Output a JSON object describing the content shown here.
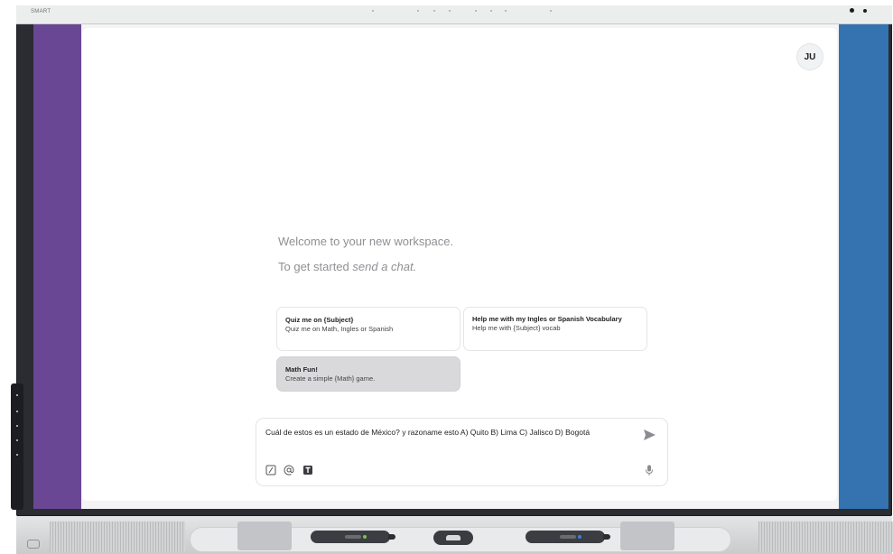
{
  "device": {
    "brand": "SMART",
    "hardware_icons": [
      "camera-icon",
      "sensor-icon",
      "power-icon",
      "pen-icon",
      "eraser-icon"
    ]
  },
  "workspace": {
    "avatar_initials": "JU",
    "welcome_text": "Welcome to your new workspace.",
    "started_prefix": "To get started ",
    "started_emphasis": "send a chat."
  },
  "suggestions": [
    {
      "title": "Quiz me on {Subject}",
      "subtitle": "Quiz me on Math, Ingles or Spanish"
    },
    {
      "title": "Help me with my Ingles or Spanish Vocabulary",
      "subtitle": "Help me with {Subject} vocab"
    },
    {
      "title": "Math Fun!",
      "subtitle": "Create a simple {Math} game."
    }
  ],
  "composer": {
    "value": "Cuál de estos es un estado de México? y razoname esto A) Quito B) Lima C) Jalisco D) Bogotá",
    "icons": [
      "slash-command-icon",
      "mention-icon",
      "text-format-icon",
      "send-icon",
      "microphone-icon"
    ]
  },
  "colors": {
    "left_panel": "#6a4795",
    "right_panel": "#3572b0",
    "active_card": "#d9d9db",
    "workspace_bg": "#ffffff"
  }
}
